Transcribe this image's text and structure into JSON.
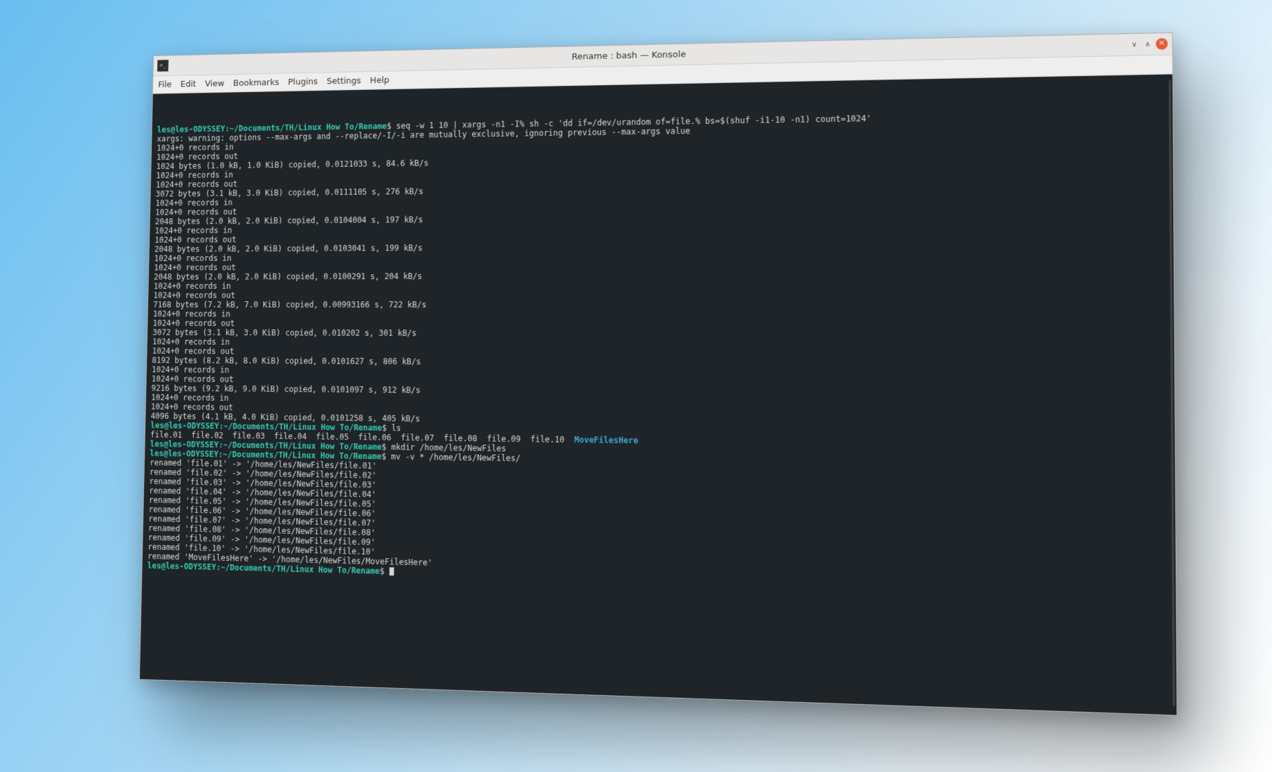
{
  "titlebar": {
    "title": "Rename : bash — Konsole",
    "minimize_tip": "Minimize",
    "maximize_tip": "Maximize",
    "close_tip": "Close"
  },
  "menubar": {
    "items": [
      "File",
      "Edit",
      "View",
      "Bookmarks",
      "Plugins",
      "Settings",
      "Help"
    ]
  },
  "terminal": {
    "prompt_user_host": "les@les-ODYSSEY",
    "prompt_sep": ":",
    "prompt_path_full": "~/Documents/TH/Linux How To/Rename",
    "dollar": "$",
    "cmd1": "seq -w 1 10 | xargs -n1 -I% sh -c 'dd if=/dev/urandom of=file.% bs=$(shuf -i1-10 -n1) count=1024'",
    "xargs_warn": "xargs: warning: options --max-args and --replace/-I/-i are mutually exclusive, ignoring previous --max-args value",
    "rec_in": "1024+0 records in",
    "rec_out": "1024+0 records out",
    "dd_lines": [
      "1024 bytes (1.0 kB, 1.0 KiB) copied, 0.0121033 s, 84.6 kB/s",
      "3072 bytes (3.1 kB, 3.0 KiB) copied, 0.0111105 s, 276 kB/s",
      "2048 bytes (2.0 kB, 2.0 KiB) copied, 0.0104004 s, 197 kB/s",
      "2048 bytes (2.0 kB, 2.0 KiB) copied, 0.0103041 s, 199 kB/s",
      "2048 bytes (2.0 kB, 2.0 KiB) copied, 0.0100291 s, 204 kB/s",
      "7168 bytes (7.2 kB, 7.0 KiB) copied, 0.00993166 s, 722 kB/s",
      "3072 bytes (3.1 kB, 3.0 KiB) copied, 0.010202 s, 301 kB/s",
      "8192 bytes (8.2 kB, 8.0 KiB) copied, 0.0101627 s, 806 kB/s",
      "9216 bytes (9.2 kB, 9.0 KiB) copied, 0.0101097 s, 912 kB/s",
      "4096 bytes (4.1 kB, 4.0 KiB) copied, 0.0101258 s, 405 kB/s"
    ],
    "cmd2": "ls",
    "ls_files_line": "file.01  file.02  file.03  file.04  file.05  file.06  file.07  file.08  file.09  file.10  ",
    "ls_dir": "MoveFilesHere",
    "cmd3": "mkdir /home/les/NewFiles",
    "cmd4": "mv -v * /home/les/NewFiles/",
    "mv_lines": [
      "renamed 'file.01' -> '/home/les/NewFiles/file.01'",
      "renamed 'file.02' -> '/home/les/NewFiles/file.02'",
      "renamed 'file.03' -> '/home/les/NewFiles/file.03'",
      "renamed 'file.04' -> '/home/les/NewFiles/file.04'",
      "renamed 'file.05' -> '/home/les/NewFiles/file.05'",
      "renamed 'file.06' -> '/home/les/NewFiles/file.06'",
      "renamed 'file.07' -> '/home/les/NewFiles/file.07'",
      "renamed 'file.08' -> '/home/les/NewFiles/file.08'",
      "renamed 'file.09' -> '/home/les/NewFiles/file.09'",
      "renamed 'file.10' -> '/home/les/NewFiles/file.10'",
      "renamed 'MoveFilesHere' -> '/home/les/NewFiles/MoveFilesHere'"
    ]
  }
}
